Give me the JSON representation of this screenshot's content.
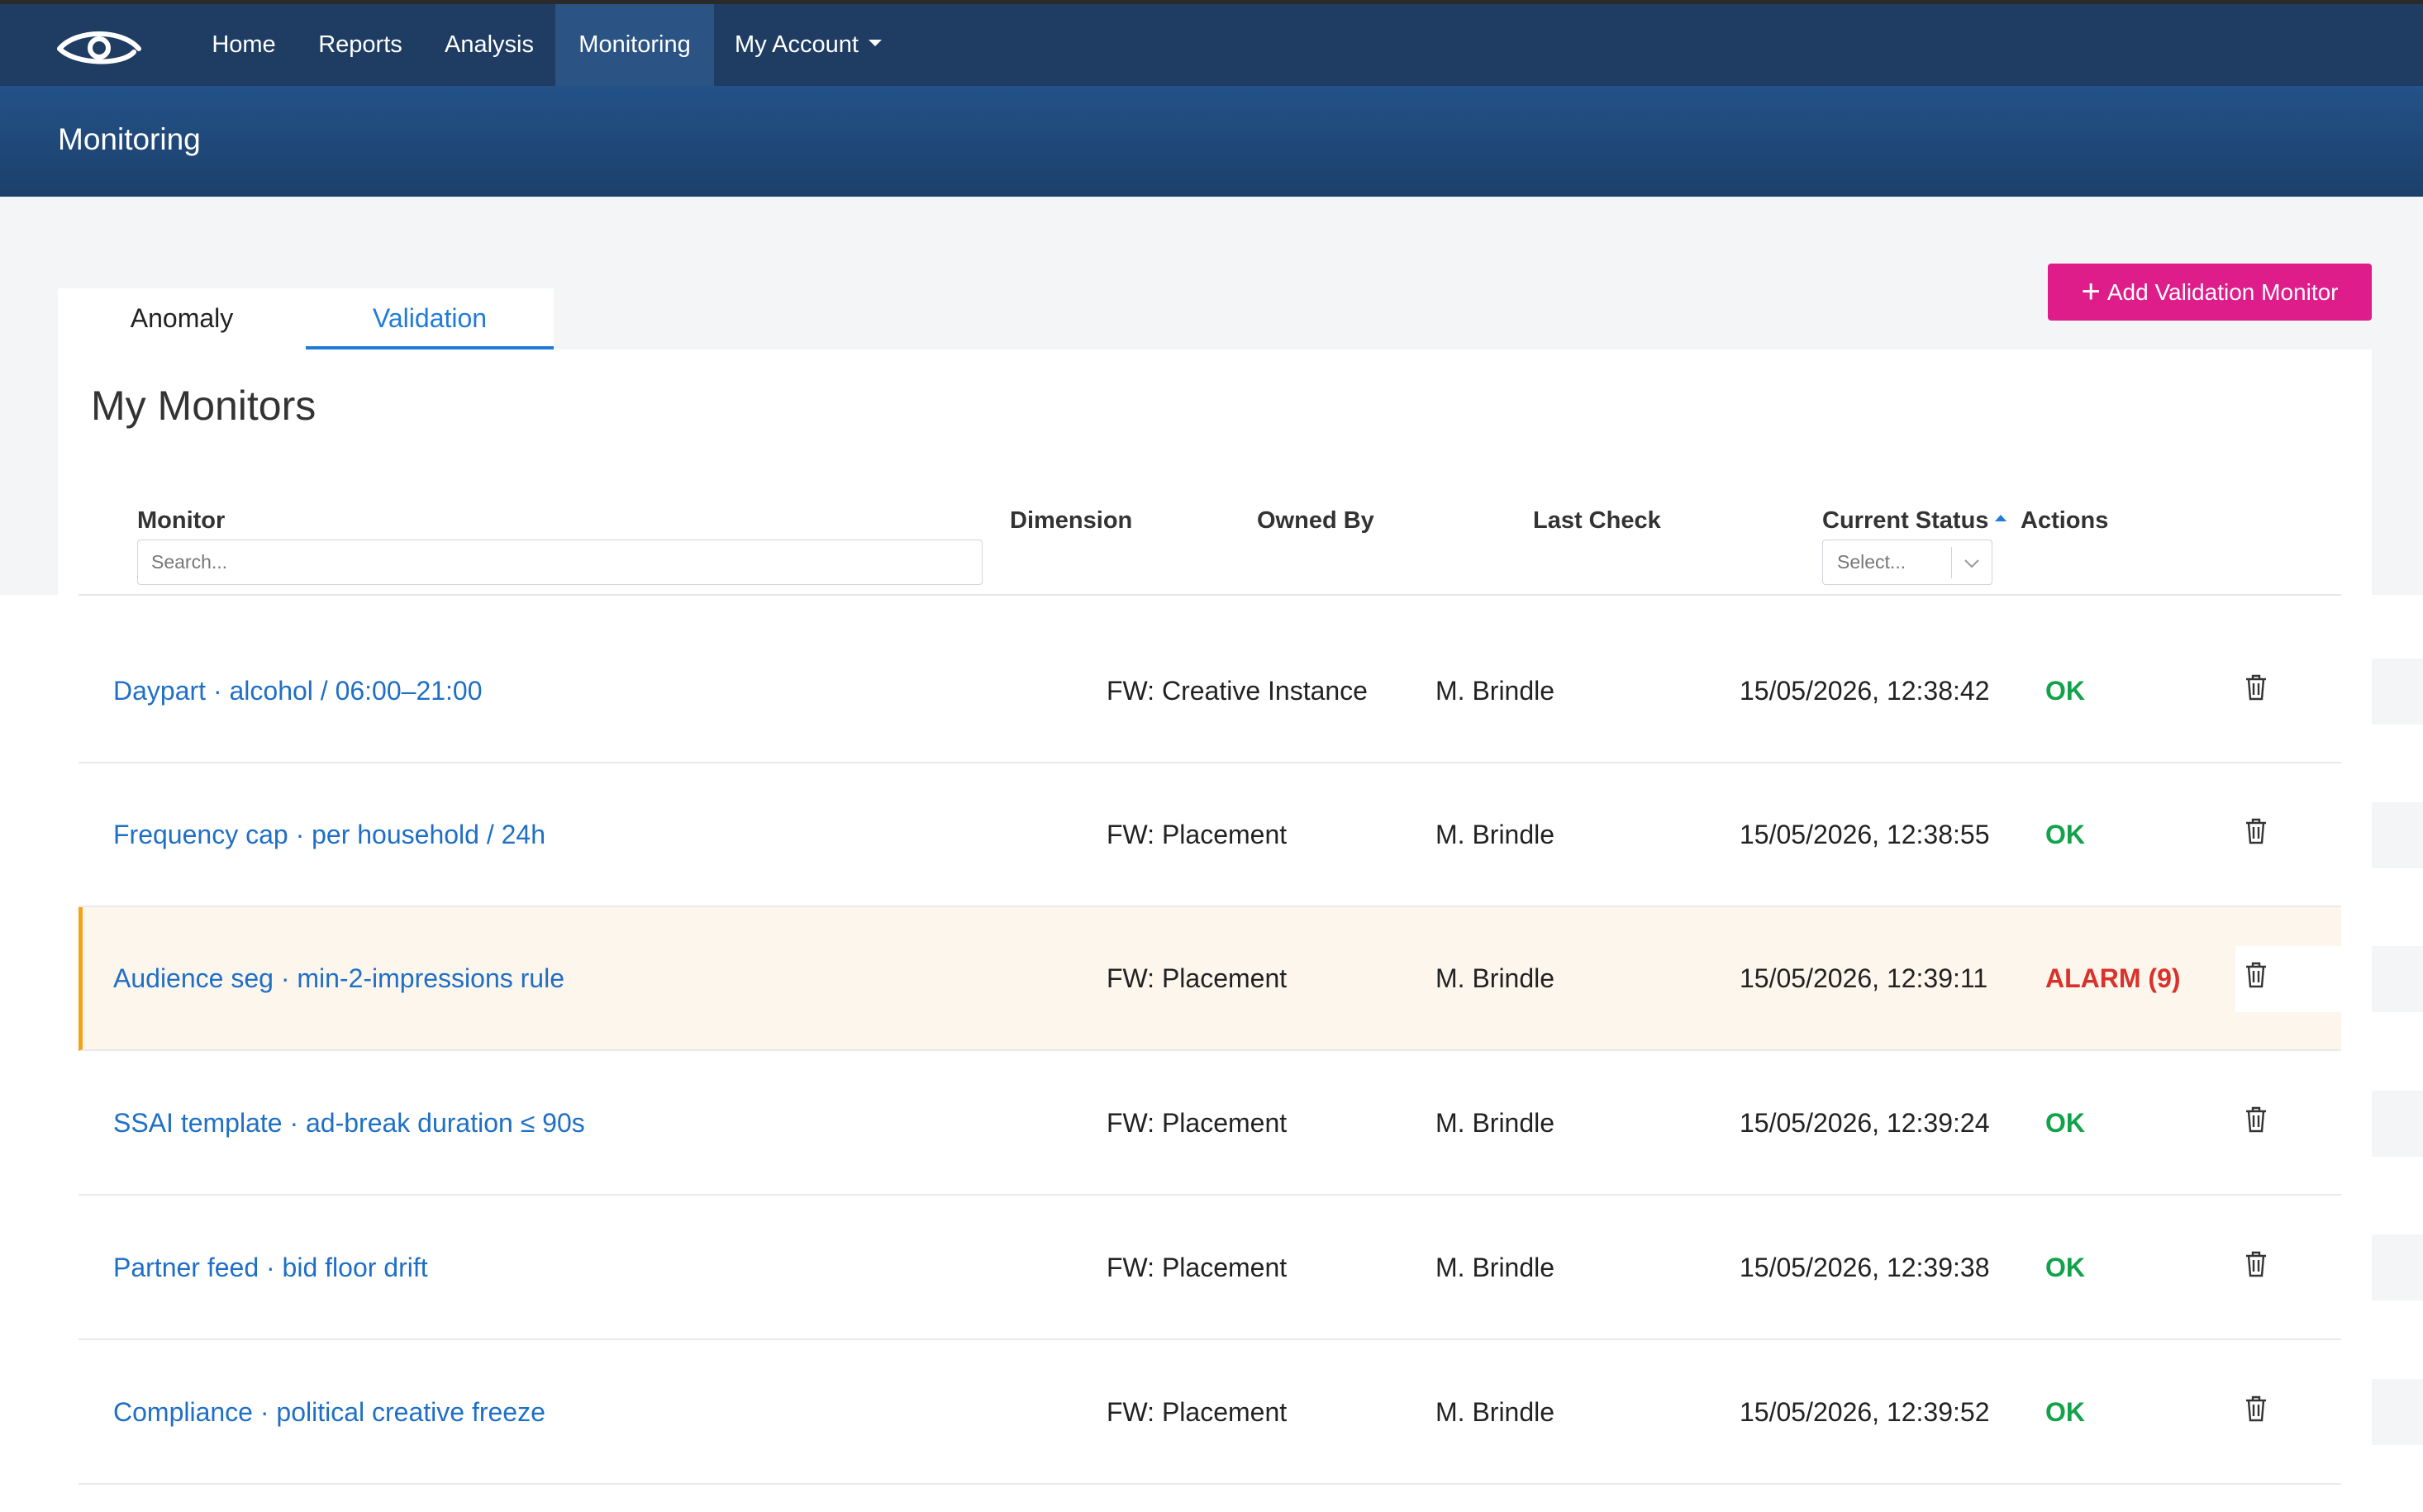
{
  "nav": {
    "logo_icon": "eye-logo-icon",
    "items": [
      {
        "label": "Home"
      },
      {
        "label": "Reports"
      },
      {
        "label": "Analysis"
      },
      {
        "label": "Monitoring",
        "active": true
      },
      {
        "label": "My Account",
        "has_dropdown": true
      }
    ]
  },
  "page": {
    "title": "Monitoring"
  },
  "tabs": [
    {
      "label": "Anomaly",
      "active": false
    },
    {
      "label": "Validation",
      "active": true
    }
  ],
  "add_button": {
    "label": "Add Validation Monitor",
    "icon": "plus-icon",
    "color": "#de1d8b"
  },
  "panel": {
    "title": "My Monitors"
  },
  "columns": {
    "monitor": "Monitor",
    "dimension": "Dimension",
    "owned_by": "Owned By",
    "last_check": "Last Check",
    "current_status": "Current Status",
    "actions": "Actions"
  },
  "filters": {
    "search_placeholder": "Search...",
    "status_placeholder": "Select..."
  },
  "rows": [
    {
      "name": "Daypart · alcohol / 06:00–21:00",
      "dimension": "FW: Creative Instance",
      "owner": "M. Brindle",
      "last_check": "15/05/2026, 12:38:42",
      "status": "OK"
    },
    {
      "name": "Frequency cap · per household / 24h",
      "dimension": "FW: Placement",
      "owner": "M. Brindle",
      "last_check": "15/05/2026, 12:38:55",
      "status": "OK"
    },
    {
      "name": "Audience seg · min-2-impressions rule",
      "dimension": "FW: Placement",
      "owner": "M. Brindle",
      "last_check": "15/05/2026, 12:39:11",
      "status": "ALARM (9)"
    },
    {
      "name": "SSAI template · ad-break duration ≤ 90s",
      "dimension": "FW: Placement",
      "owner": "M. Brindle",
      "last_check": "15/05/2026, 12:39:24",
      "status": "OK"
    },
    {
      "name": "Partner feed · bid floor drift",
      "dimension": "FW: Placement",
      "owner": "M. Brindle",
      "last_check": "15/05/2026, 12:39:38",
      "status": "OK"
    },
    {
      "name": "Compliance · political creative freeze",
      "dimension": "FW: Placement",
      "owner": "M. Brindle",
      "last_check": "15/05/2026, 12:39:52",
      "status": "OK"
    }
  ],
  "colors": {
    "nav_bg": "#1f3d63",
    "accent": "#1f7bd8",
    "ok": "#12a24a",
    "alarm": "#d8322c",
    "alarm_row_bg": "#fdf6ec",
    "alarm_row_border": "#f2a31c"
  }
}
